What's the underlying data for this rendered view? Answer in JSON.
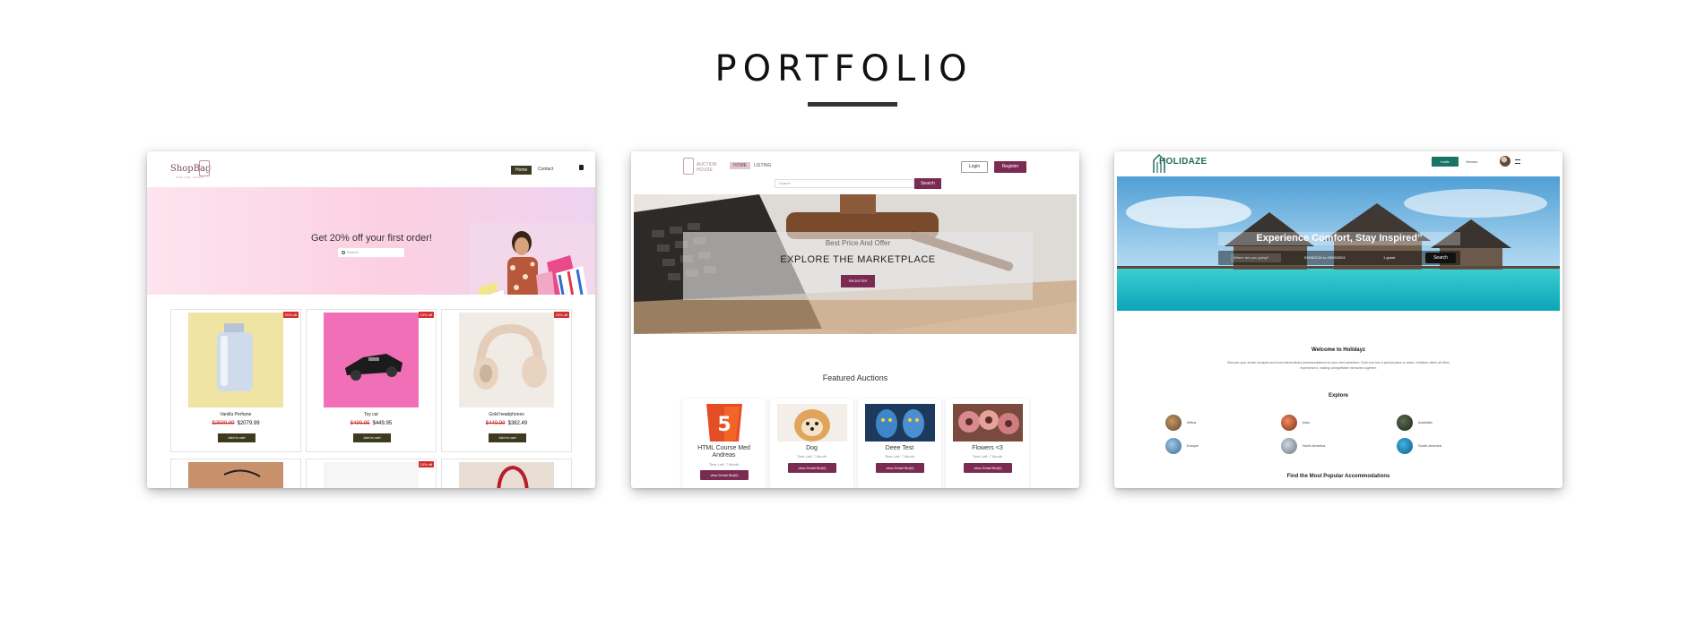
{
  "section": {
    "title": "PORTFOLIO"
  },
  "shopbag": {
    "logo": "ShopBag",
    "logo_tagline": "ONLINE SHOP",
    "nav_home": "Home",
    "nav_contact": "Contact",
    "hero_text": "Get 20% off your first order!",
    "search_placeholder": "Search",
    "products": [
      {
        "name": "Vanilla Perfume",
        "old_price": "$2599.99",
        "price": "$2079.99",
        "badge": "20% off",
        "button": "Add to cart"
      },
      {
        "name": "Toy car",
        "old_price": "$499.95",
        "price": "$449.95",
        "badge": "10% off",
        "button": "Add to cart"
      },
      {
        "name": "Gold headphones",
        "old_price": "$449.99",
        "price": "$382.49",
        "badge": "15% off",
        "button": "Add to cart"
      }
    ],
    "row2_badge": "10% off"
  },
  "auction": {
    "logo_line1": "AUCTION",
    "logo_line2": "HOUSE",
    "nav_home": "HOME",
    "nav_listing": "LISTING",
    "login": "Login",
    "register": "Register",
    "search_placeholder": "Search",
    "search_button": "Search",
    "hero_subtitle": "Best Price And Offer",
    "hero_title": "EXPLORE THE MARKETPLACE",
    "hero_button": "REGISTER",
    "featured_title": "Featured Auctions",
    "items": [
      {
        "name_line1": "HTML Course Med",
        "name_line2": "Andreas",
        "time": "Time Left: 7 Month",
        "button": "view Detail Bid(0)"
      },
      {
        "name_line1": "Dog",
        "name_line2": "",
        "time": "Time Left: 7 Month",
        "button": "view Detail Bid(0)"
      },
      {
        "name_line1": "Deee Test",
        "name_line2": "",
        "time": "Time Left: 7 Month",
        "button": "view Detail Bid(0)"
      },
      {
        "name_line1": "Flowers <3",
        "name_line2": "",
        "time": "Time Left: 7 Month",
        "button": "view Detail Bid(0)"
      }
    ]
  },
  "holidaze": {
    "logo": "HOLIDAZE",
    "invite": "Invite",
    "venues": "Venues",
    "hero_title": "Experience Comfort, Stay Inspired”",
    "where_placeholder": "Where are you going?",
    "dates": "03/08/2024 to 03/09/2024",
    "guests": "1 guest",
    "search_button": "Search",
    "welcome_title": "Welcome to Holidayz",
    "description_line1": "Discover your dream escapes and book extraordinary accommodations for your next adventure. Each one has a special place to share. Holidaze offers all offers",
    "description_line2": "experience it, making unforgettable memories together.",
    "explore_title": "Explore",
    "regions": [
      "Africa",
      "Asia",
      "Australia",
      "Europe",
      "North America",
      "South America"
    ],
    "popular_title": "Find the Most Popular Accommodations"
  }
}
